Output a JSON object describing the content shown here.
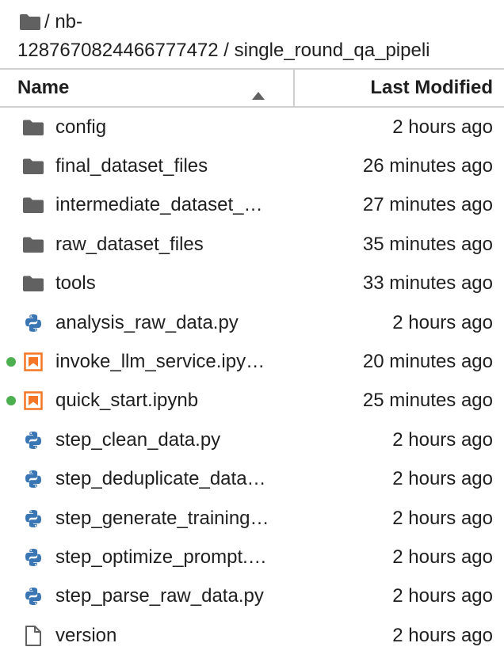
{
  "breadcrumb": {
    "line1": "/ nb-",
    "line2": "1287670824466777472 / single_round_qa_pipeli"
  },
  "header": {
    "name_label": "Name",
    "modified_label": "Last Modified"
  },
  "files": [
    {
      "icon": "folder-icon",
      "name": "config",
      "modified": "2 hours ago",
      "running": false
    },
    {
      "icon": "folder-icon",
      "name": "final_dataset_files",
      "modified": "26 minutes ago",
      "running": false
    },
    {
      "icon": "folder-icon",
      "name": "intermediate_dataset_…",
      "modified": "27 minutes ago",
      "running": false
    },
    {
      "icon": "folder-icon",
      "name": "raw_dataset_files",
      "modified": "35 minutes ago",
      "running": false
    },
    {
      "icon": "folder-icon",
      "name": "tools",
      "modified": "33 minutes ago",
      "running": false
    },
    {
      "icon": "python-icon",
      "name": "analysis_raw_data.py",
      "modified": "2 hours ago",
      "running": false
    },
    {
      "icon": "notebook-icon",
      "name": "invoke_llm_service.ipy…",
      "modified": "20 minutes ago",
      "running": true
    },
    {
      "icon": "notebook-icon",
      "name": "quick_start.ipynb",
      "modified": "25 minutes ago",
      "running": true
    },
    {
      "icon": "python-icon",
      "name": "step_clean_data.py",
      "modified": "2 hours ago",
      "running": false
    },
    {
      "icon": "python-icon",
      "name": "step_deduplicate_data…",
      "modified": "2 hours ago",
      "running": false
    },
    {
      "icon": "python-icon",
      "name": "step_generate_training…",
      "modified": "2 hours ago",
      "running": false
    },
    {
      "icon": "python-icon",
      "name": "step_optimize_prompt.…",
      "modified": "2 hours ago",
      "running": false
    },
    {
      "icon": "python-icon",
      "name": "step_parse_raw_data.py",
      "modified": "2 hours ago",
      "running": false
    },
    {
      "icon": "file-icon",
      "name": "version",
      "modified": "2 hours ago",
      "running": false
    }
  ],
  "colors": {
    "folder": "#616161",
    "python_blue": "#3a76b4",
    "python_yellow": "#ffd43b",
    "notebook": "#f37726",
    "running_dot": "#4caf50"
  }
}
